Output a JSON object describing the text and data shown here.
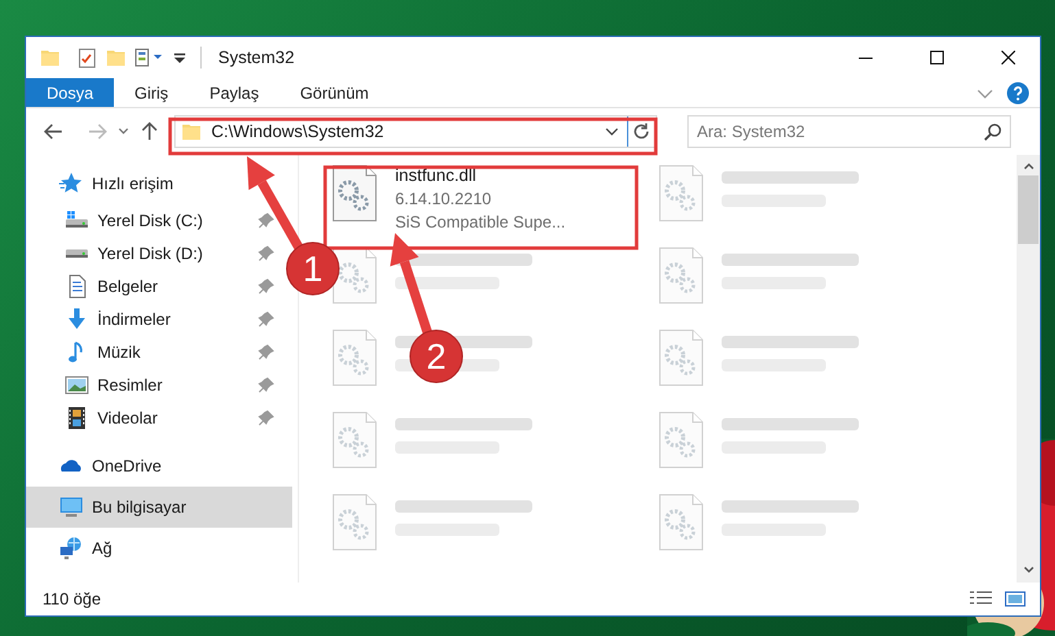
{
  "window": {
    "title": "System32"
  },
  "ribbon_tabs": [
    {
      "label": "Dosya",
      "selected": true
    },
    {
      "label": "Giriş",
      "selected": false
    },
    {
      "label": "Paylaş",
      "selected": false
    },
    {
      "label": "Görünüm",
      "selected": false
    }
  ],
  "address_bar": {
    "path": "C:\\Windows\\System32"
  },
  "search": {
    "placeholder": "Ara: System32"
  },
  "sidebar": {
    "items": [
      {
        "label": "Hızlı erişim",
        "selected": false,
        "children": [
          {
            "label": "Yerel Disk (C:)",
            "pinned": true
          },
          {
            "label": "Yerel Disk (D:)",
            "pinned": true
          },
          {
            "label": "Belgeler",
            "pinned": true
          },
          {
            "label": "İndirmeler",
            "pinned": true
          },
          {
            "label": "Müzik",
            "pinned": true
          },
          {
            "label": "Resimler",
            "pinned": true
          },
          {
            "label": "Videolar",
            "pinned": true
          }
        ]
      },
      {
        "label": "OneDrive",
        "selected": false
      },
      {
        "label": "Bu bilgisayar",
        "selected": true
      },
      {
        "label": "Ağ",
        "selected": false
      }
    ]
  },
  "files": [
    {
      "kind": "file",
      "name": "instfunc.dll",
      "details": [
        "6.14.10.2210",
        "SiS Compatible Supe..."
      ]
    },
    {
      "kind": "blurred"
    },
    {
      "kind": "blurred"
    },
    {
      "kind": "blurred"
    },
    {
      "kind": "blurred"
    },
    {
      "kind": "blurred"
    },
    {
      "kind": "blurred"
    },
    {
      "kind": "blurred"
    },
    {
      "kind": "blurred"
    },
    {
      "kind": "blurred"
    }
  ],
  "status_bar": {
    "item_count": "110 öğe"
  },
  "annotations": [
    {
      "label": "1"
    },
    {
      "label": "2"
    }
  ]
}
